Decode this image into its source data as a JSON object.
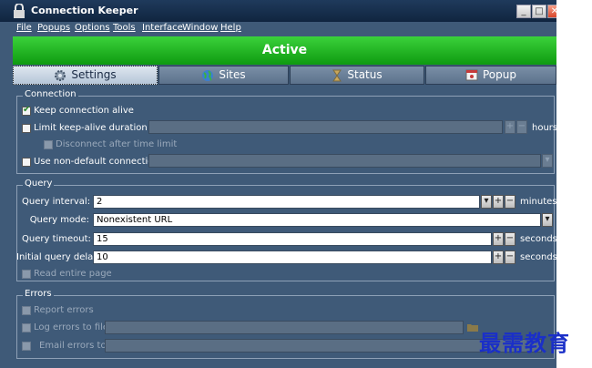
{
  "window": {
    "title": "Connection Keeper",
    "minimize": "_",
    "maximize": "□",
    "close": "✕"
  },
  "menu": [
    "File",
    "Popups",
    "Options",
    "Tools",
    "Interface",
    "Window",
    "Help"
  ],
  "status": {
    "label": "Active",
    "color": "#1ca81c"
  },
  "tabs": [
    {
      "label": "Settings",
      "icon": "gear-icon"
    },
    {
      "label": "Sites",
      "icon": "globe-icon"
    },
    {
      "label": "Status",
      "icon": "hourglass-icon"
    },
    {
      "label": "Popup",
      "icon": "window-icon"
    }
  ],
  "connection": {
    "legend": "Connection",
    "keep_alive": {
      "label": "Keep connection alive",
      "checked": true
    },
    "limit_duration": {
      "label": "Limit keep-alive duration to:",
      "checked": false,
      "value": "",
      "unit": "hours"
    },
    "disconnect_after": {
      "label": "Disconnect after time limit",
      "checked": false
    },
    "non_default": {
      "label": "Use non-default connection:",
      "checked": false,
      "value": ""
    }
  },
  "query": {
    "legend": "Query",
    "interval": {
      "label": "Query interval:",
      "value": "2",
      "unit": "minutes"
    },
    "mode": {
      "label": "Query mode:",
      "value": "Nonexistent URL"
    },
    "timeout": {
      "label": "Query timeout:",
      "value": "15",
      "unit": "seconds"
    },
    "initial_delay": {
      "label": "Initial query delay:",
      "value": "10",
      "unit": "seconds"
    },
    "read_entire": {
      "label": "Read entire page",
      "checked": false
    }
  },
  "errors": {
    "legend": "Errors",
    "report": {
      "label": "Report errors",
      "checked": false
    },
    "log_file": {
      "label": "Log errors to file:",
      "checked": false,
      "value": ""
    },
    "email": {
      "label": "Email errors to:",
      "checked": false,
      "value": ""
    }
  },
  "spin": {
    "up": "+",
    "down": "−",
    "dropdown": "▾"
  },
  "watermark": "最需教育"
}
